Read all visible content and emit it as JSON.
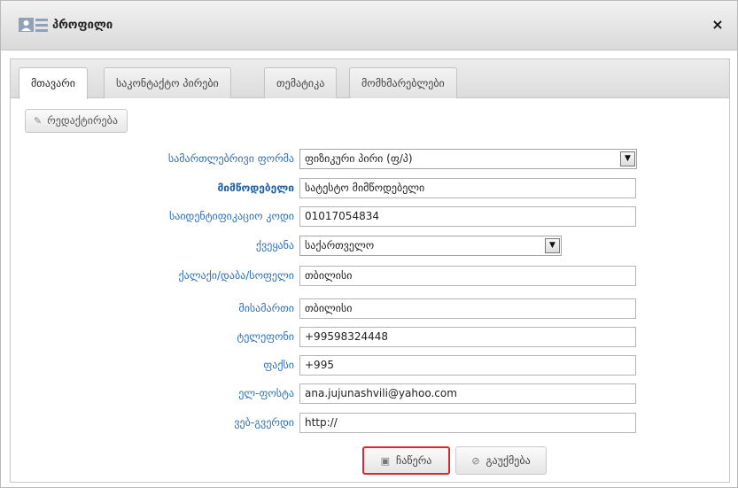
{
  "dialog": {
    "title": "პროფილი",
    "close_icon": "×"
  },
  "tabs": [
    {
      "label": "მთავარი",
      "active": true
    },
    {
      "label": "საკონტაქტო პირები",
      "active": false
    },
    {
      "label": "თემატიკა",
      "active": false
    },
    {
      "label": "მომხმარებლები",
      "active": false
    }
  ],
  "toolbar": {
    "edit_label": "რედაქტირება",
    "edit_icon": "pencil-icon"
  },
  "form": {
    "legal_form": {
      "label": "სამართლებრივი ფორმა",
      "value": "ფიზიკური პირი (ფ/პ)"
    },
    "supplier": {
      "label": "მიმწოდებელი",
      "value": "სატესტო მიმწოდებელი"
    },
    "id_code": {
      "label": "საიდენტიფიკაციო კოდი",
      "value": "01017054834"
    },
    "country": {
      "label": "ქვეყანა",
      "value": "საქართველო"
    },
    "city": {
      "label": "ქალაქი/დაბა/სოფელი",
      "value": "თბილისი"
    },
    "address": {
      "label": "მისამართი",
      "value": "თბილისი"
    },
    "phone": {
      "label": "ტელეფონი",
      "value": "+99598324448"
    },
    "fax": {
      "label": "ფაქსი",
      "value": "+995"
    },
    "email": {
      "label": "ელ-ფოსტა",
      "value": "ana.jujunashvili@yahoo.com"
    },
    "website": {
      "label": "ვებ-გვერდი",
      "value": "http://"
    }
  },
  "actions": {
    "save_label": "ჩაწერა",
    "cancel_label": "გაუქმება"
  }
}
